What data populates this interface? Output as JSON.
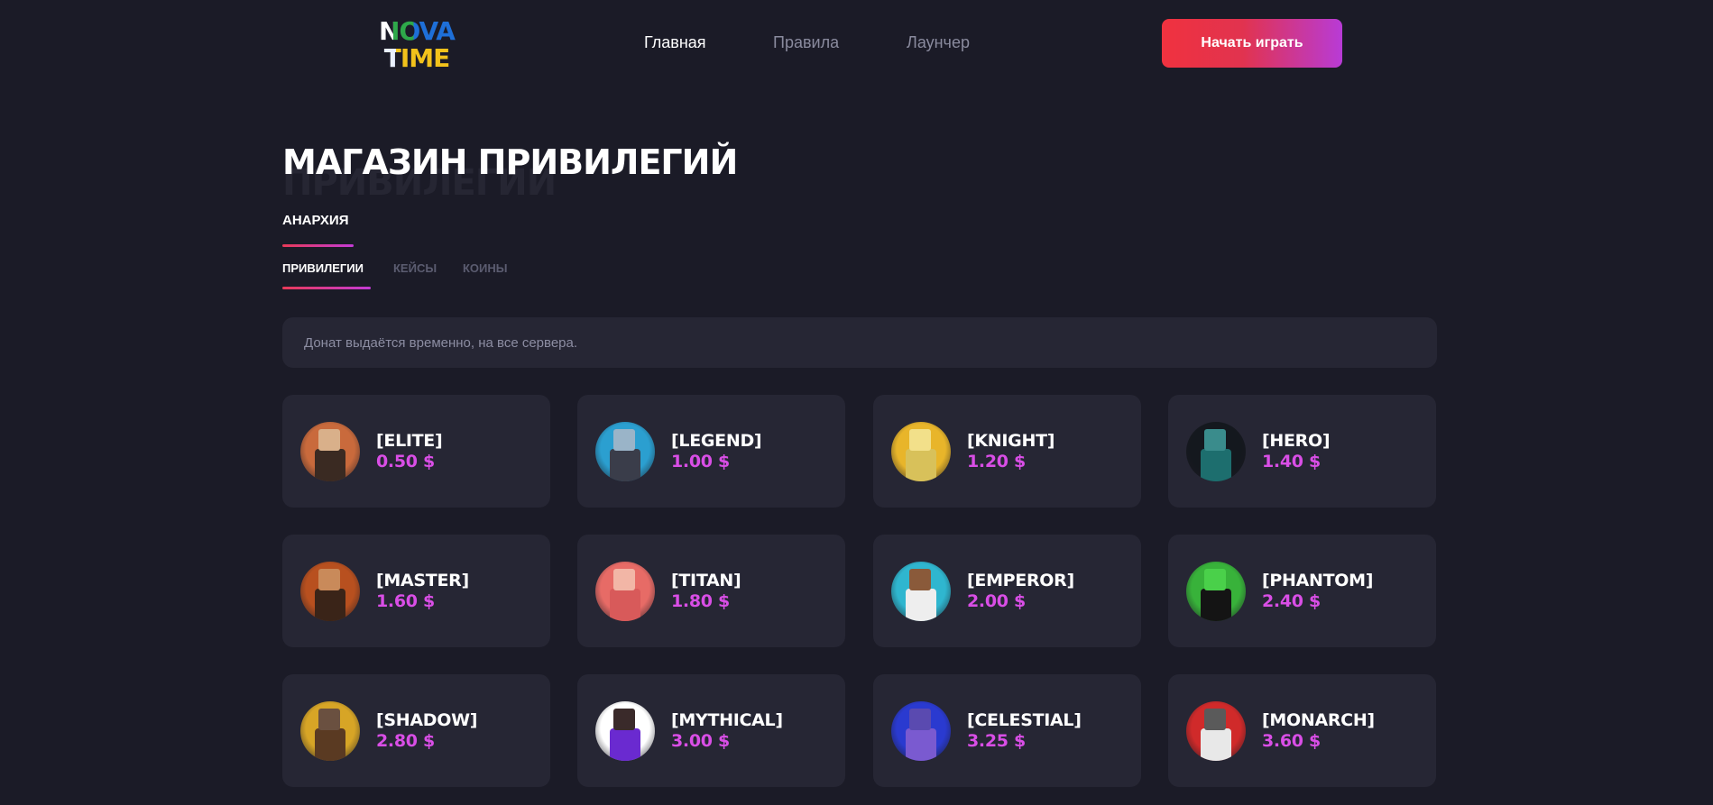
{
  "header": {
    "logo_line1": "NOVA",
    "logo_line2": "TIME",
    "nav": [
      {
        "label": "Главная",
        "active": true
      },
      {
        "label": "Правила",
        "active": false
      },
      {
        "label": "Лаунчер",
        "active": false
      }
    ],
    "play_button": "Начать играть"
  },
  "page": {
    "title": "МАГАЗИН ПРИВИЛЕГИЙ",
    "title_shadow": "ПРИВИЛЕГИИ"
  },
  "server_tab": {
    "label": "АНАРХИЯ",
    "active": true
  },
  "subtabs": [
    {
      "label": "ПРИВИЛЕГИИ",
      "active": true
    },
    {
      "label": "КЕЙСЫ",
      "active": false
    },
    {
      "label": "КОИНЫ",
      "active": false
    }
  ],
  "notice": "Донат выдаётся временно, на все сервера.",
  "colors": {
    "background": "#1b1b27",
    "card": "#262634",
    "price": "#d94ee6",
    "accent_start": "#f0323f",
    "accent_end": "#b83bd6"
  },
  "products": [
    {
      "name": "[ELITE]",
      "price": "0.50 $",
      "bg": "#c96a3c",
      "skin": "#3a2a22",
      "head": "#d9b08a"
    },
    {
      "name": "[LEGEND]",
      "price": "1.00 $",
      "bg": "#2b9fd0",
      "skin": "#3a3d4a",
      "head": "#9ab4c8"
    },
    {
      "name": "[KNIGHT]",
      "price": "1.20 $",
      "bg": "#e8b52a",
      "skin": "#d8c15a",
      "head": "#f2e08a"
    },
    {
      "name": "[HERO]",
      "price": "1.40 $",
      "bg": "#14181e",
      "skin": "#1d6e6e",
      "head": "#3a8c8c"
    },
    {
      "name": "[MASTER]",
      "price": "1.60 $",
      "bg": "#b8501f",
      "skin": "#3a2418",
      "head": "#c98a5a"
    },
    {
      "name": "[TITAN]",
      "price": "1.80 $",
      "bg": "#e76b66",
      "skin": "#d85a5a",
      "head": "#f2b6a6"
    },
    {
      "name": "[EMPEROR]",
      "price": "2.00 $",
      "bg": "#2fb6cf",
      "skin": "#eeeeee",
      "head": "#8a5a3a"
    },
    {
      "name": "[PHANTOM]",
      "price": "2.40 $",
      "bg": "#38b23a",
      "skin": "#141414",
      "head": "#4ad04a"
    },
    {
      "name": "[SHADOW]",
      "price": "2.80 $",
      "bg": "#d7a526",
      "skin": "#5a3a22",
      "head": "#6a5040"
    },
    {
      "name": "[MYTHICAL]",
      "price": "3.00 $",
      "bg": "#ffffff",
      "skin": "#6a2ad0",
      "head": "#3a2a2a"
    },
    {
      "name": "[CELESTIAL]",
      "price": "3.25 $",
      "bg": "#2a3ad0",
      "skin": "#7a5ad0",
      "head": "#5a4ab0"
    },
    {
      "name": "[MONARCH]",
      "price": "3.60 $",
      "bg": "#d02a2a",
      "skin": "#e8e8e8",
      "head": "#5a5a5a"
    }
  ]
}
